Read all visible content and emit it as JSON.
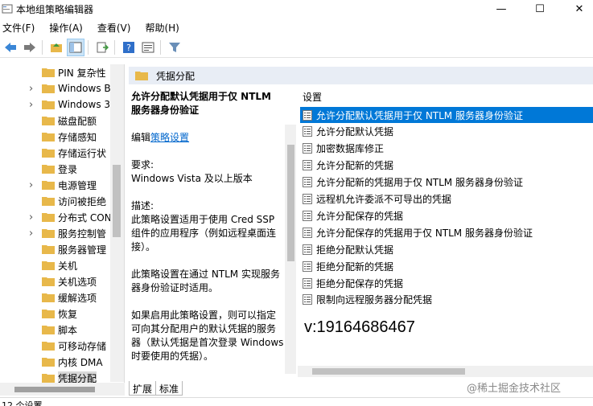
{
  "window": {
    "title": "本地组策略编辑器"
  },
  "menu": [
    "文件(F)",
    "操作(A)",
    "查看(V)",
    "帮助(H)"
  ],
  "tree": {
    "items": [
      {
        "label": "PIN 复杂性",
        "has_children": false
      },
      {
        "label": "Windows B",
        "has_children": true
      },
      {
        "label": "Windows 3",
        "has_children": true
      },
      {
        "label": "磁盘配额",
        "has_children": false
      },
      {
        "label": "存储感知",
        "has_children": false
      },
      {
        "label": "存储运行状",
        "has_children": false
      },
      {
        "label": "登录",
        "has_children": false
      },
      {
        "label": "电源管理",
        "has_children": true
      },
      {
        "label": "访问被拒绝",
        "has_children": false
      },
      {
        "label": "分布式 CON",
        "has_children": true
      },
      {
        "label": "服务控制管",
        "has_children": true
      },
      {
        "label": "服务器管理",
        "has_children": false
      },
      {
        "label": "关机",
        "has_children": false
      },
      {
        "label": "关机选项",
        "has_children": false
      },
      {
        "label": "缓解选项",
        "has_children": false
      },
      {
        "label": "恢复",
        "has_children": false
      },
      {
        "label": "脚本",
        "has_children": false
      },
      {
        "label": "可移动存储",
        "has_children": false
      },
      {
        "label": "内核 DMA",
        "has_children": false
      },
      {
        "label": "凭据分配",
        "has_children": false,
        "selected": true
      }
    ]
  },
  "right_header": {
    "title": "凭据分配"
  },
  "description": {
    "title": "允许分配默认凭据用于仅 NTLM 服务器身份验证",
    "edit_prefix": "编辑",
    "edit_link": "策略设置",
    "req_label": "要求:",
    "req_value": "Windows Vista 及以上版本",
    "desc_label": "描述:",
    "desc_p1": "此策略设置适用于使用 Cred SSP 组件的应用程序（例如远程桌面连接）。",
    "desc_p2": "此策略设置在通过 NTLM 实现服务器身份验证时适用。",
    "desc_p3": "如果启用此策略设置，则可以指定可向其分配用户的默认凭据的服务器（默认凭据是首次登录 Windows 时要使用的凭据）。"
  },
  "settings": {
    "header": "设置",
    "items": [
      {
        "label": "允许分配默认凭据用于仅 NTLM 服务器身份验证",
        "selected": true
      },
      {
        "label": "允许分配默认凭据"
      },
      {
        "label": "加密数据库修正"
      },
      {
        "label": "允许分配新的凭据"
      },
      {
        "label": "允许分配新的凭据用于仅 NTLM 服务器身份验证"
      },
      {
        "label": "远程机允许委派不可导出的凭据"
      },
      {
        "label": "允许分配保存的凭据"
      },
      {
        "label": "允许分配保存的凭据用于仅 NTLM 服务器身份验证"
      },
      {
        "label": "拒绝分配默认凭据"
      },
      {
        "label": "拒绝分配新的凭据"
      },
      {
        "label": "拒绝分配保存的凭据"
      },
      {
        "label": "限制向远程服务器分配凭据"
      }
    ]
  },
  "overlay_text": "v:19164686467",
  "tabs": [
    "扩展",
    "标准"
  ],
  "status": "12 个设置",
  "watermark": "@稀土掘金技术社区",
  "colors": {
    "selection": "#0078d7",
    "folder": "#e8b84a",
    "header_bg": "#e8edf5"
  }
}
